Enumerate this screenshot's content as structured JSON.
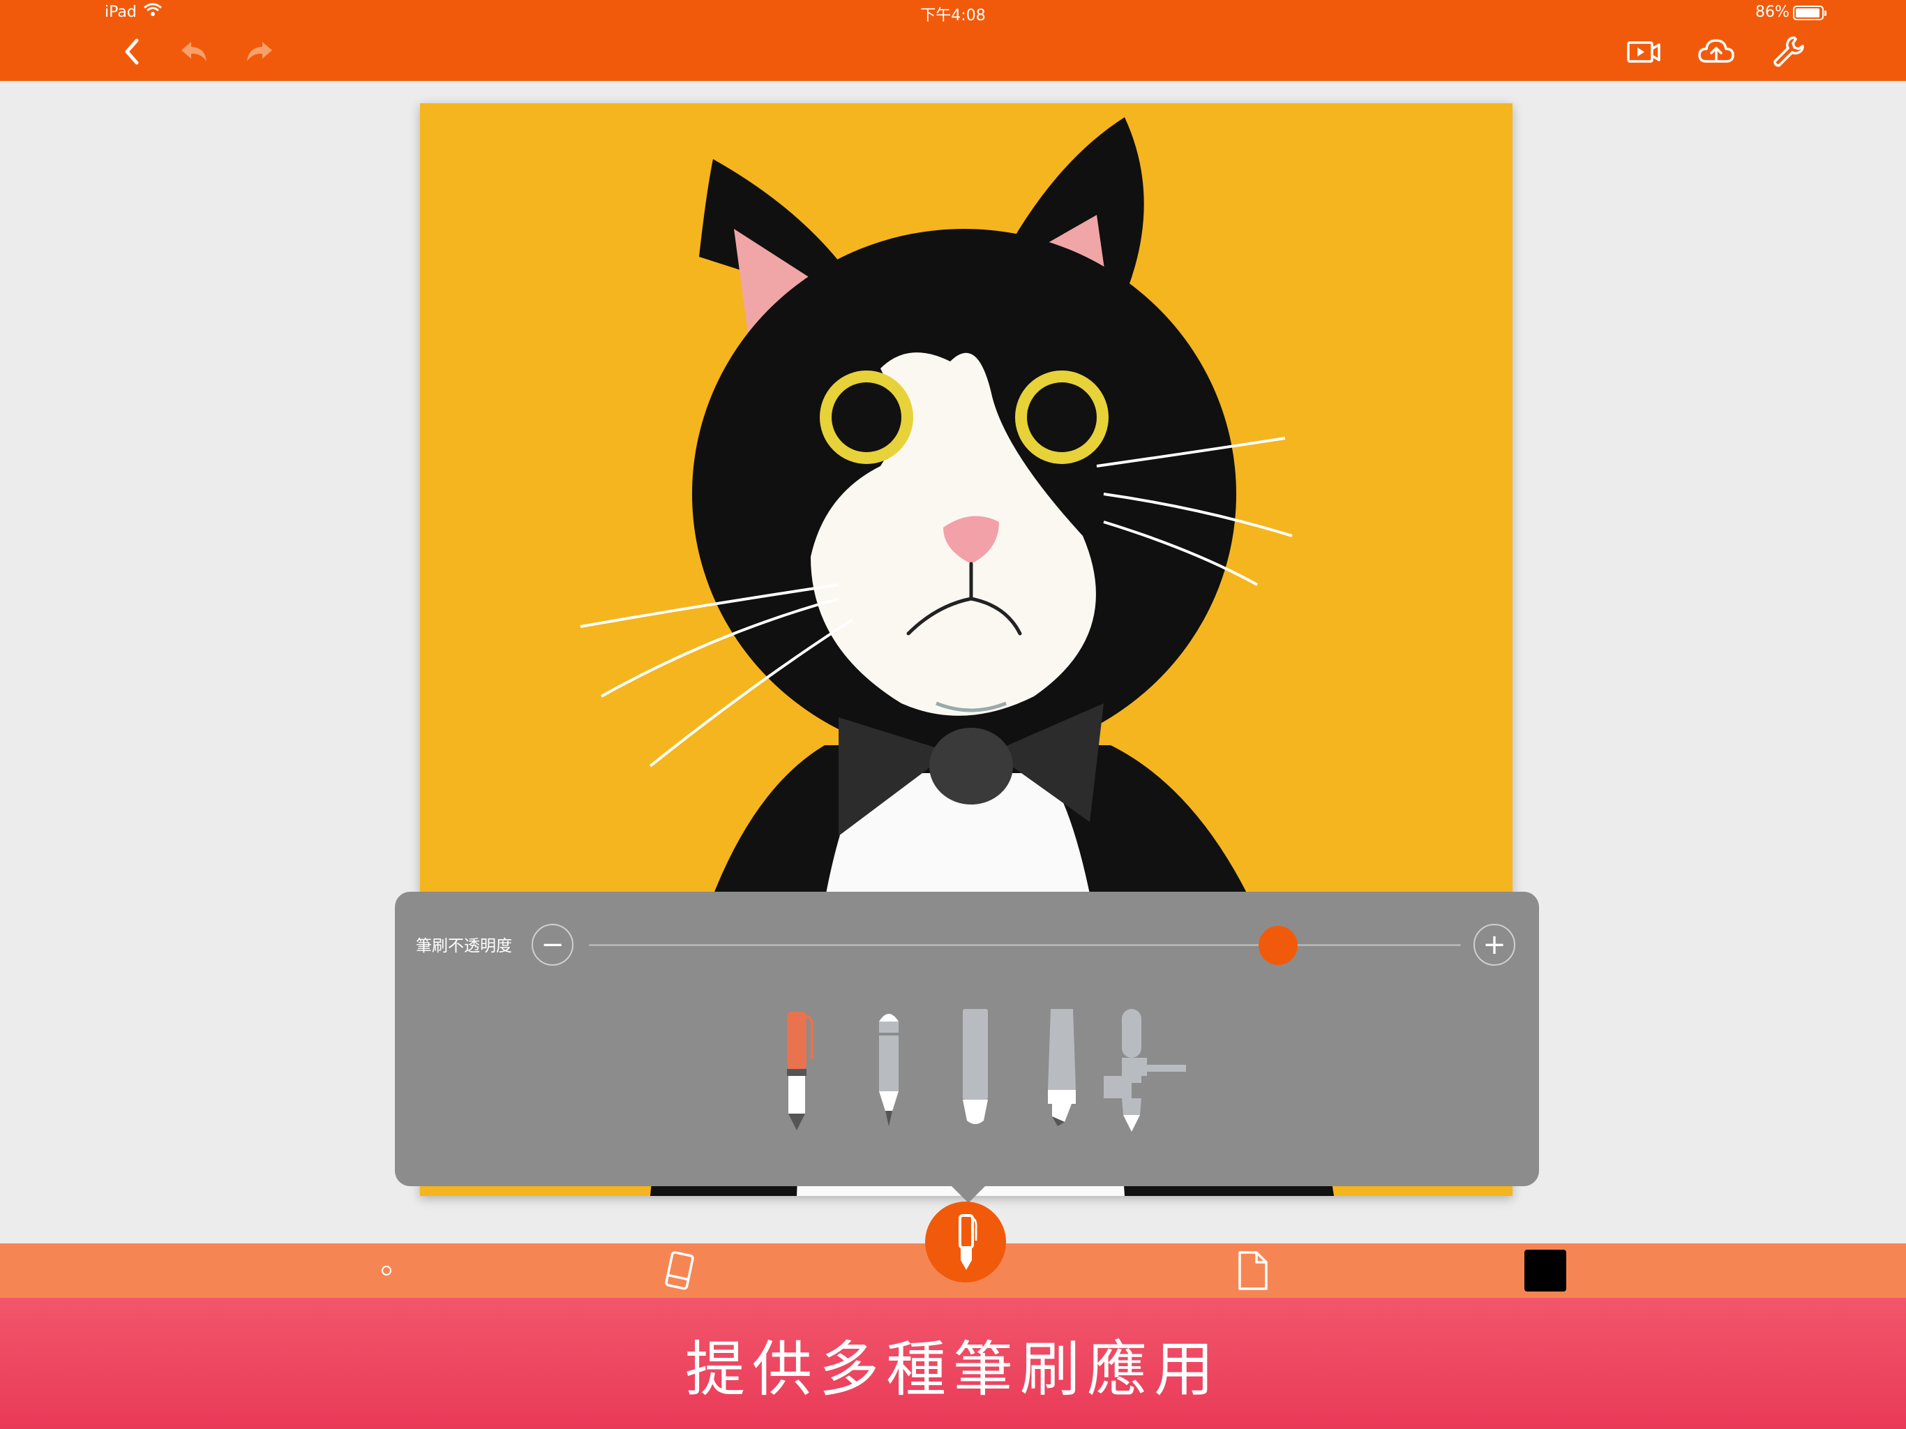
{
  "status_bar": {
    "device": "iPad",
    "time": "下午4:08",
    "battery": "86%"
  },
  "toolbar": {
    "left_icons": [
      "back-chevron-icon",
      "undo-icon",
      "redo-icon"
    ],
    "right_icons": [
      "video-icon",
      "cloud-upload-icon",
      "wrench-icon"
    ]
  },
  "colors": {
    "brand_orange": "#f25a0b",
    "bottom_bar": "#f58654",
    "canvas_bg": "#f5b51e",
    "popover": "#8c8c8c",
    "banner": "#e93a58"
  },
  "brush_panel": {
    "opacity_label": "筆刷不透明度",
    "minus": "−",
    "plus": "+",
    "opacity_value": 0.79,
    "brushes": [
      "pen-icon",
      "pencil-icon",
      "marker-icon",
      "highlighter-icon",
      "airbrush-icon"
    ],
    "selected_brush": "pen-icon"
  },
  "bottom_bar": {
    "tools": [
      "brush-size-dot-icon",
      "eraser-icon",
      "pen-icon",
      "layer-page-icon",
      "color-swatch"
    ],
    "active_tool": "pen-icon",
    "current_color": "#000000"
  },
  "banner": {
    "caption": "提供多種筆刷應用"
  }
}
